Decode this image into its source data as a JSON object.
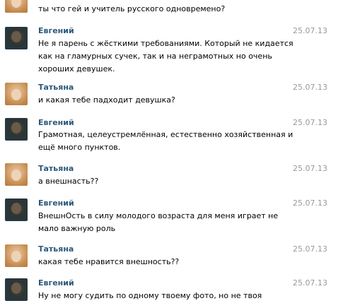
{
  "messages": [
    {
      "author": "",
      "date": "",
      "text": "ты что гей и учитель русского одновремено?"
    },
    {
      "author": "Евгений",
      "date": "25.07.13",
      "text": "Не я парень с жёсткими требованиями. Который не кидается как на гламурных сучек, так и на неграмотных но очень хороших девушек."
    },
    {
      "author": "Татьяна",
      "date": "25.07.13",
      "text": "и какая тебе падходит девушка?"
    },
    {
      "author": "Евгений",
      "date": "25.07.13",
      "text": "Грамотная, целеустремлённая, естественно хозяйственная и ещё много пунктов."
    },
    {
      "author": "Татьяна",
      "date": "25.07.13",
      "text": "а внешнасть??"
    },
    {
      "author": "Евгений",
      "date": "25.07.13",
      "text": "ВнешнОсть в силу молодого возраста для меня играет не мало важную роль"
    },
    {
      "author": "Татьяна",
      "date": "25.07.13",
      "text": "какая тебе нравится внешность??"
    },
    {
      "author": "Евгений",
      "date": "25.07.13",
      "text": "Ну не могу судить по одному твоему фото, но не твоя"
    }
  ]
}
